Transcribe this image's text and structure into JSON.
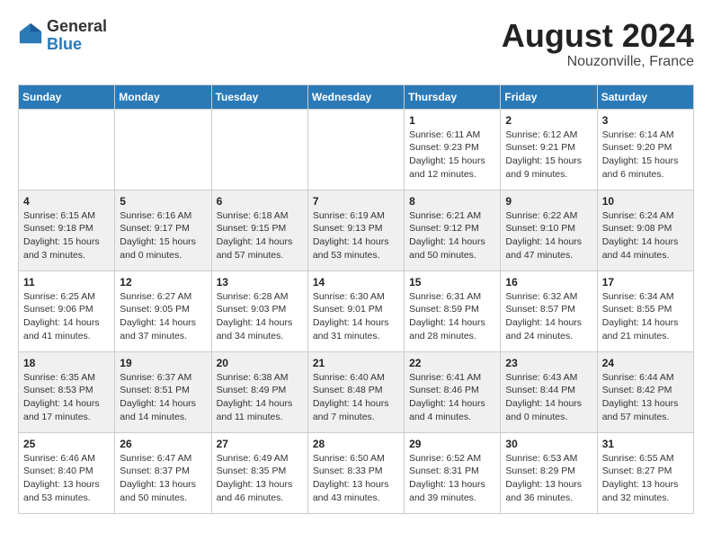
{
  "header": {
    "logo": {
      "line1": "General",
      "line2": "Blue"
    },
    "title": "August 2024",
    "subtitle": "Nouzonville, France"
  },
  "calendar": {
    "weekdays": [
      "Sunday",
      "Monday",
      "Tuesday",
      "Wednesday",
      "Thursday",
      "Friday",
      "Saturday"
    ],
    "rows": [
      [
        {
          "day": "",
          "info": ""
        },
        {
          "day": "",
          "info": ""
        },
        {
          "day": "",
          "info": ""
        },
        {
          "day": "",
          "info": ""
        },
        {
          "day": "1",
          "info": "Sunrise: 6:11 AM\nSunset: 9:23 PM\nDaylight: 15 hours and 12 minutes."
        },
        {
          "day": "2",
          "info": "Sunrise: 6:12 AM\nSunset: 9:21 PM\nDaylight: 15 hours and 9 minutes."
        },
        {
          "day": "3",
          "info": "Sunrise: 6:14 AM\nSunset: 9:20 PM\nDaylight: 15 hours and 6 minutes."
        }
      ],
      [
        {
          "day": "4",
          "info": "Sunrise: 6:15 AM\nSunset: 9:18 PM\nDaylight: 15 hours and 3 minutes."
        },
        {
          "day": "5",
          "info": "Sunrise: 6:16 AM\nSunset: 9:17 PM\nDaylight: 15 hours and 0 minutes."
        },
        {
          "day": "6",
          "info": "Sunrise: 6:18 AM\nSunset: 9:15 PM\nDaylight: 14 hours and 57 minutes."
        },
        {
          "day": "7",
          "info": "Sunrise: 6:19 AM\nSunset: 9:13 PM\nDaylight: 14 hours and 53 minutes."
        },
        {
          "day": "8",
          "info": "Sunrise: 6:21 AM\nSunset: 9:12 PM\nDaylight: 14 hours and 50 minutes."
        },
        {
          "day": "9",
          "info": "Sunrise: 6:22 AM\nSunset: 9:10 PM\nDaylight: 14 hours and 47 minutes."
        },
        {
          "day": "10",
          "info": "Sunrise: 6:24 AM\nSunset: 9:08 PM\nDaylight: 14 hours and 44 minutes."
        }
      ],
      [
        {
          "day": "11",
          "info": "Sunrise: 6:25 AM\nSunset: 9:06 PM\nDaylight: 14 hours and 41 minutes."
        },
        {
          "day": "12",
          "info": "Sunrise: 6:27 AM\nSunset: 9:05 PM\nDaylight: 14 hours and 37 minutes."
        },
        {
          "day": "13",
          "info": "Sunrise: 6:28 AM\nSunset: 9:03 PM\nDaylight: 14 hours and 34 minutes."
        },
        {
          "day": "14",
          "info": "Sunrise: 6:30 AM\nSunset: 9:01 PM\nDaylight: 14 hours and 31 minutes."
        },
        {
          "day": "15",
          "info": "Sunrise: 6:31 AM\nSunset: 8:59 PM\nDaylight: 14 hours and 28 minutes."
        },
        {
          "day": "16",
          "info": "Sunrise: 6:32 AM\nSunset: 8:57 PM\nDaylight: 14 hours and 24 minutes."
        },
        {
          "day": "17",
          "info": "Sunrise: 6:34 AM\nSunset: 8:55 PM\nDaylight: 14 hours and 21 minutes."
        }
      ],
      [
        {
          "day": "18",
          "info": "Sunrise: 6:35 AM\nSunset: 8:53 PM\nDaylight: 14 hours and 17 minutes."
        },
        {
          "day": "19",
          "info": "Sunrise: 6:37 AM\nSunset: 8:51 PM\nDaylight: 14 hours and 14 minutes."
        },
        {
          "day": "20",
          "info": "Sunrise: 6:38 AM\nSunset: 8:49 PM\nDaylight: 14 hours and 11 minutes."
        },
        {
          "day": "21",
          "info": "Sunrise: 6:40 AM\nSunset: 8:48 PM\nDaylight: 14 hours and 7 minutes."
        },
        {
          "day": "22",
          "info": "Sunrise: 6:41 AM\nSunset: 8:46 PM\nDaylight: 14 hours and 4 minutes."
        },
        {
          "day": "23",
          "info": "Sunrise: 6:43 AM\nSunset: 8:44 PM\nDaylight: 14 hours and 0 minutes."
        },
        {
          "day": "24",
          "info": "Sunrise: 6:44 AM\nSunset: 8:42 PM\nDaylight: 13 hours and 57 minutes."
        }
      ],
      [
        {
          "day": "25",
          "info": "Sunrise: 6:46 AM\nSunset: 8:40 PM\nDaylight: 13 hours and 53 minutes."
        },
        {
          "day": "26",
          "info": "Sunrise: 6:47 AM\nSunset: 8:37 PM\nDaylight: 13 hours and 50 minutes."
        },
        {
          "day": "27",
          "info": "Sunrise: 6:49 AM\nSunset: 8:35 PM\nDaylight: 13 hours and 46 minutes."
        },
        {
          "day": "28",
          "info": "Sunrise: 6:50 AM\nSunset: 8:33 PM\nDaylight: 13 hours and 43 minutes."
        },
        {
          "day": "29",
          "info": "Sunrise: 6:52 AM\nSunset: 8:31 PM\nDaylight: 13 hours and 39 minutes."
        },
        {
          "day": "30",
          "info": "Sunrise: 6:53 AM\nSunset: 8:29 PM\nDaylight: 13 hours and 36 minutes."
        },
        {
          "day": "31",
          "info": "Sunrise: 6:55 AM\nSunset: 8:27 PM\nDaylight: 13 hours and 32 minutes."
        }
      ]
    ]
  }
}
